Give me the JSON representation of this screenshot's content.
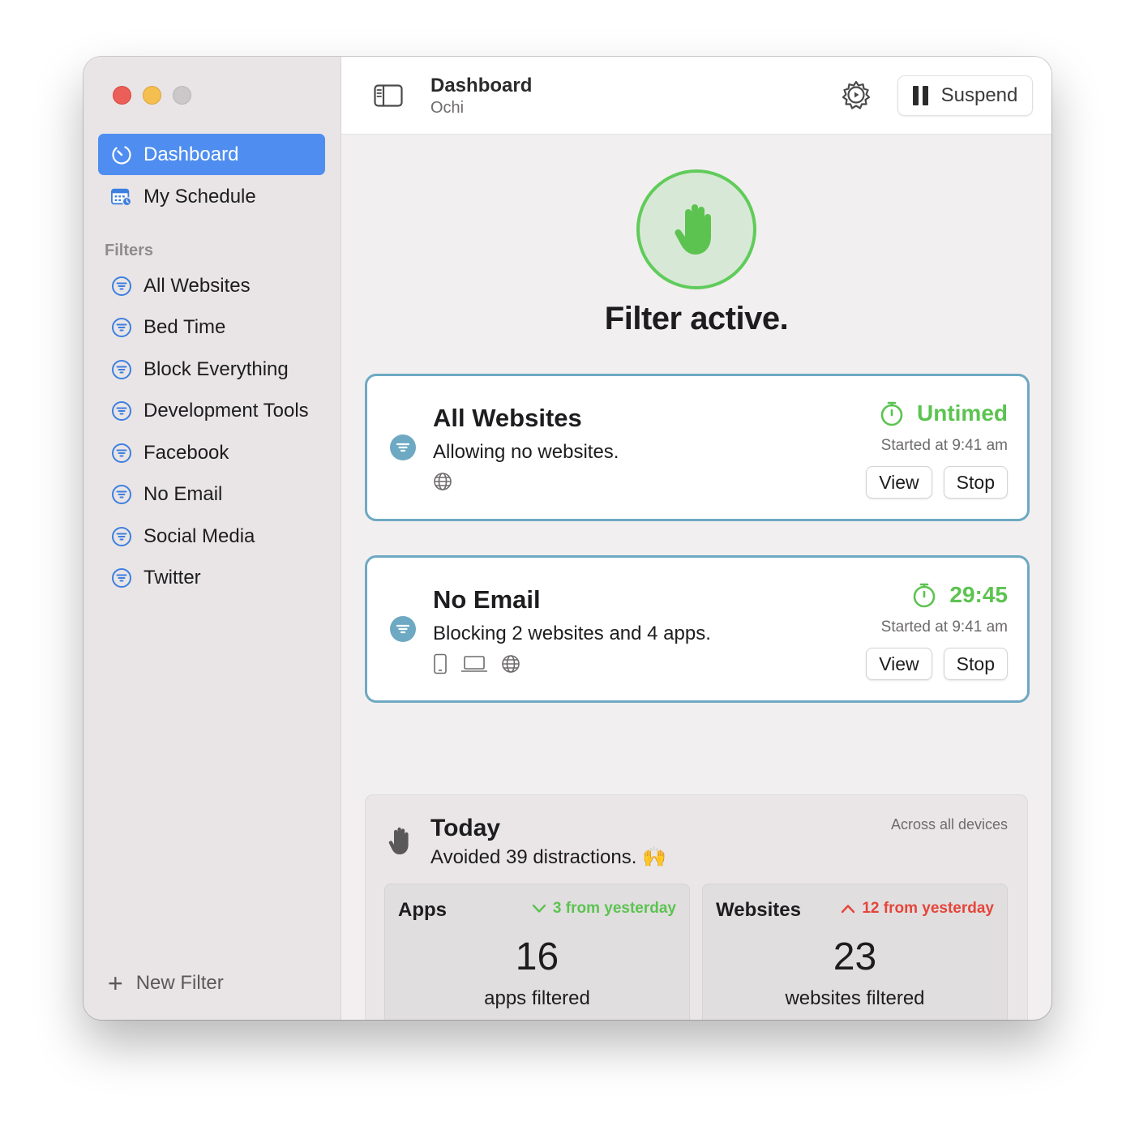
{
  "sidebar": {
    "nav": [
      {
        "label": "Dashboard",
        "active": true
      },
      {
        "label": "My Schedule",
        "active": false
      }
    ],
    "section_label": "Filters",
    "filters": [
      {
        "label": "All Websites"
      },
      {
        "label": "Bed Time"
      },
      {
        "label": "Block Everything"
      },
      {
        "label": "Development Tools"
      },
      {
        "label": "Facebook"
      },
      {
        "label": "No Email"
      },
      {
        "label": "Social Media"
      },
      {
        "label": "Twitter"
      }
    ],
    "new_filter_label": "New Filter"
  },
  "toolbar": {
    "title": "Dashboard",
    "subtitle": "Ochi",
    "suspend_label": "Suspend"
  },
  "status": {
    "title": "Filter active."
  },
  "active_filters": [
    {
      "name": "All Websites",
      "description": "Allowing no websites.",
      "timer": "Untimed",
      "started": "Started at 9:41 am",
      "view_label": "View",
      "stop_label": "Stop",
      "devices": [
        "globe-icon"
      ]
    },
    {
      "name": "No Email",
      "description": "Blocking 2 websites and 4 apps.",
      "timer": "29:45",
      "started": "Started at 9:41 am",
      "view_label": "View",
      "stop_label": "Stop",
      "devices": [
        "phone-icon",
        "laptop-icon",
        "globe-icon"
      ]
    }
  ],
  "today": {
    "title": "Today",
    "subtitle": "Avoided 39 distractions. 🙌",
    "scope": "Across all devices",
    "apps": {
      "label": "Apps",
      "delta": "3 from yesterday",
      "delta_direction": "down",
      "number": "16",
      "caption": "apps filtered"
    },
    "websites": {
      "label": "Websites",
      "delta": "12 from yesterday",
      "delta_direction": "up",
      "number": "23",
      "caption": "websites filtered"
    }
  },
  "colors": {
    "accent": "#4f8ef0",
    "active_green": "#5cc351",
    "card_border": "#6da9c2",
    "delta_down": "#5cc351",
    "delta_up": "#e5453a",
    "filter_icon_blue": "#3d7fe0"
  }
}
